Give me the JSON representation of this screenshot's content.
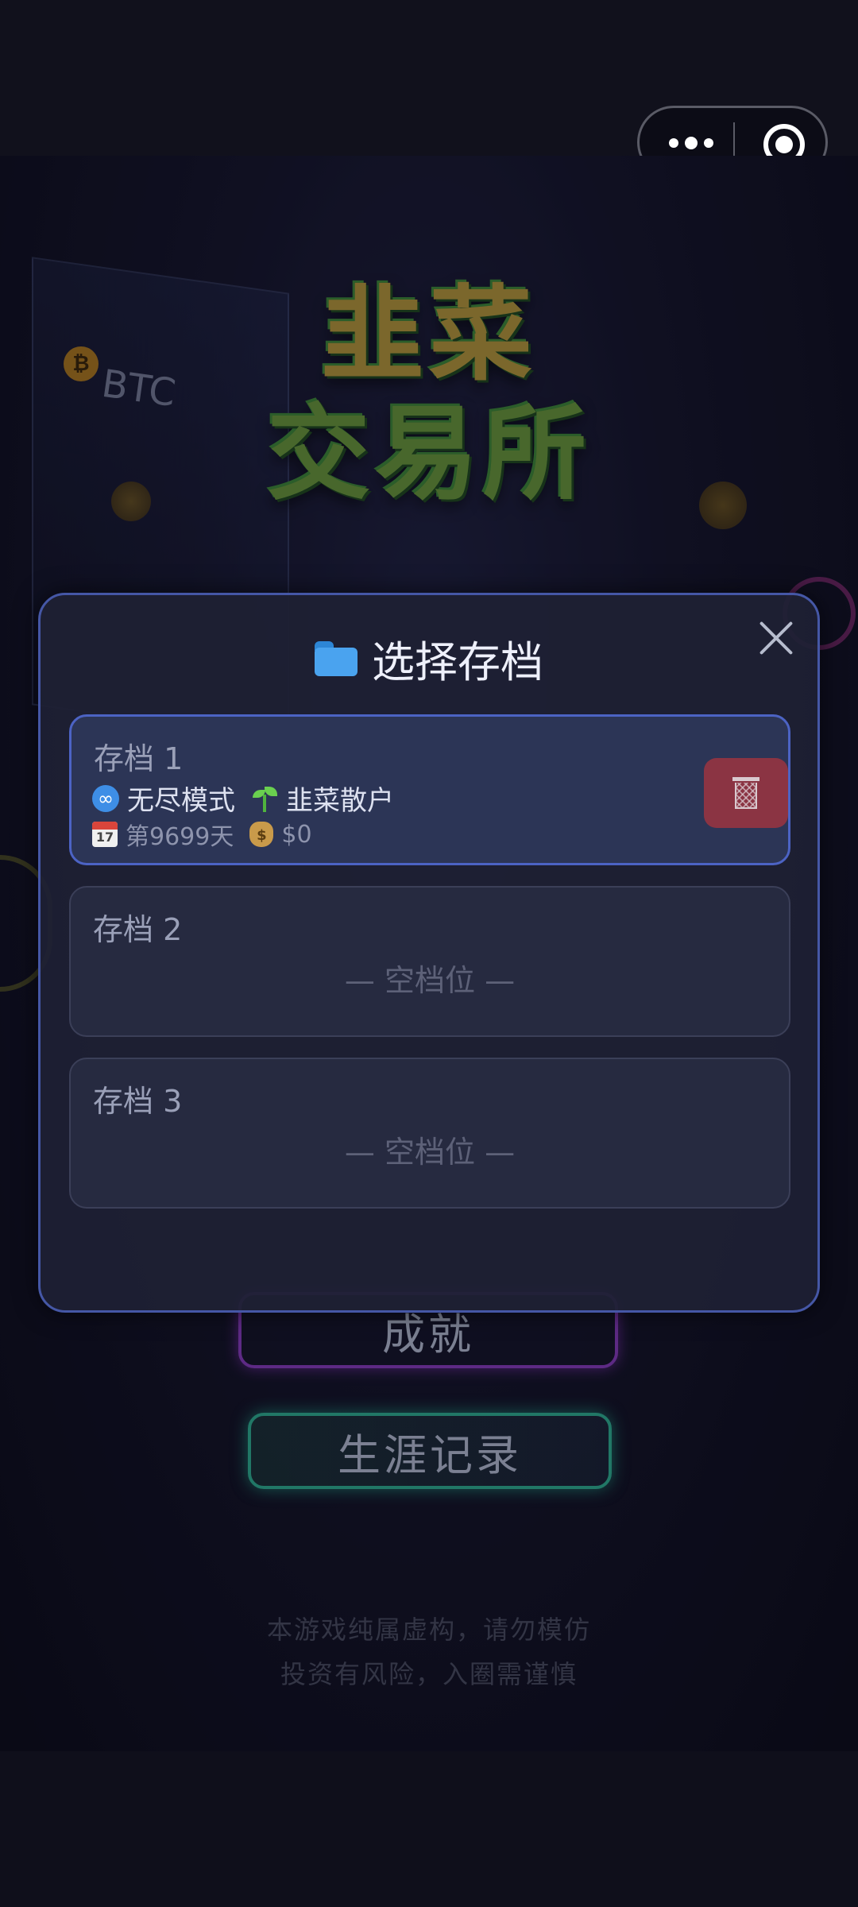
{
  "background": {
    "game_title_line1": "韭菜",
    "game_title_line2": "交易所",
    "chart_ticker": "BTC",
    "menu": {
      "achievements_label": "成就",
      "career_label": "生涯记录"
    },
    "disclaimer": [
      "本游戏纯属虚构，请勿模仿",
      "投资有风险，入圈需谨慎"
    ]
  },
  "modal": {
    "title": "选择存档",
    "title_icon": "folder-icon",
    "close_icon": "close-icon",
    "slots": [
      {
        "label": "存档 1",
        "mode": "无尽模式",
        "rank": "韭菜散户",
        "day": "第9699天",
        "money": "$0",
        "delete_icon": "trash-icon",
        "active": true
      },
      {
        "label": "存档 2",
        "empty_text": "— 空档位 —"
      },
      {
        "label": "存档 3",
        "empty_text": "— 空档位 —"
      }
    ]
  },
  "colors": {
    "modal_border": "#4557a6",
    "active_slot_border": "#4c63c4",
    "delete_button": "#8b3443",
    "achievement_glow": "#8a3cc0",
    "career_glow": "#2fb392"
  }
}
